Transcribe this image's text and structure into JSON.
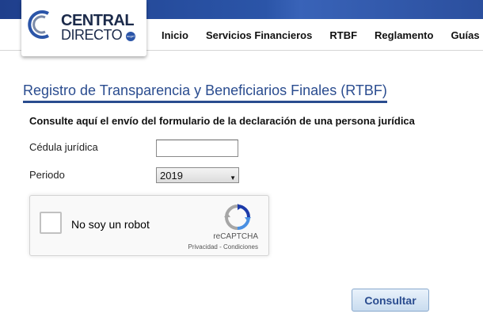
{
  "header": {
    "logo": {
      "line1": "CENTRAL",
      "line2": "DIRECTO",
      "badge": "sugef"
    },
    "nav": [
      {
        "label": "Inicio"
      },
      {
        "label": "Servicios Financieros"
      },
      {
        "label": "RTBF"
      },
      {
        "label": "Reglamento"
      },
      {
        "label": "Guías"
      }
    ]
  },
  "form": {
    "title": "Registro de Transparencia y Beneficiarios Finales (RTBF)",
    "subtitle": "Consulte aquí el envío del formulario de la declaración de una persona jurídica",
    "cedula_label": "Cédula jurídica",
    "cedula_value": "",
    "periodo_label": "Periodo",
    "periodo_value": "2019",
    "submit_label": "Consultar"
  },
  "captcha": {
    "label": "No soy un robot",
    "brand": "reCAPTCHA",
    "privacy": "Privacidad",
    "separator": " - ",
    "terms": "Condiciones"
  },
  "colors": {
    "topbar": "#2b55a8",
    "title": "#2a4c8f",
    "button_text": "#2a4c8f"
  }
}
